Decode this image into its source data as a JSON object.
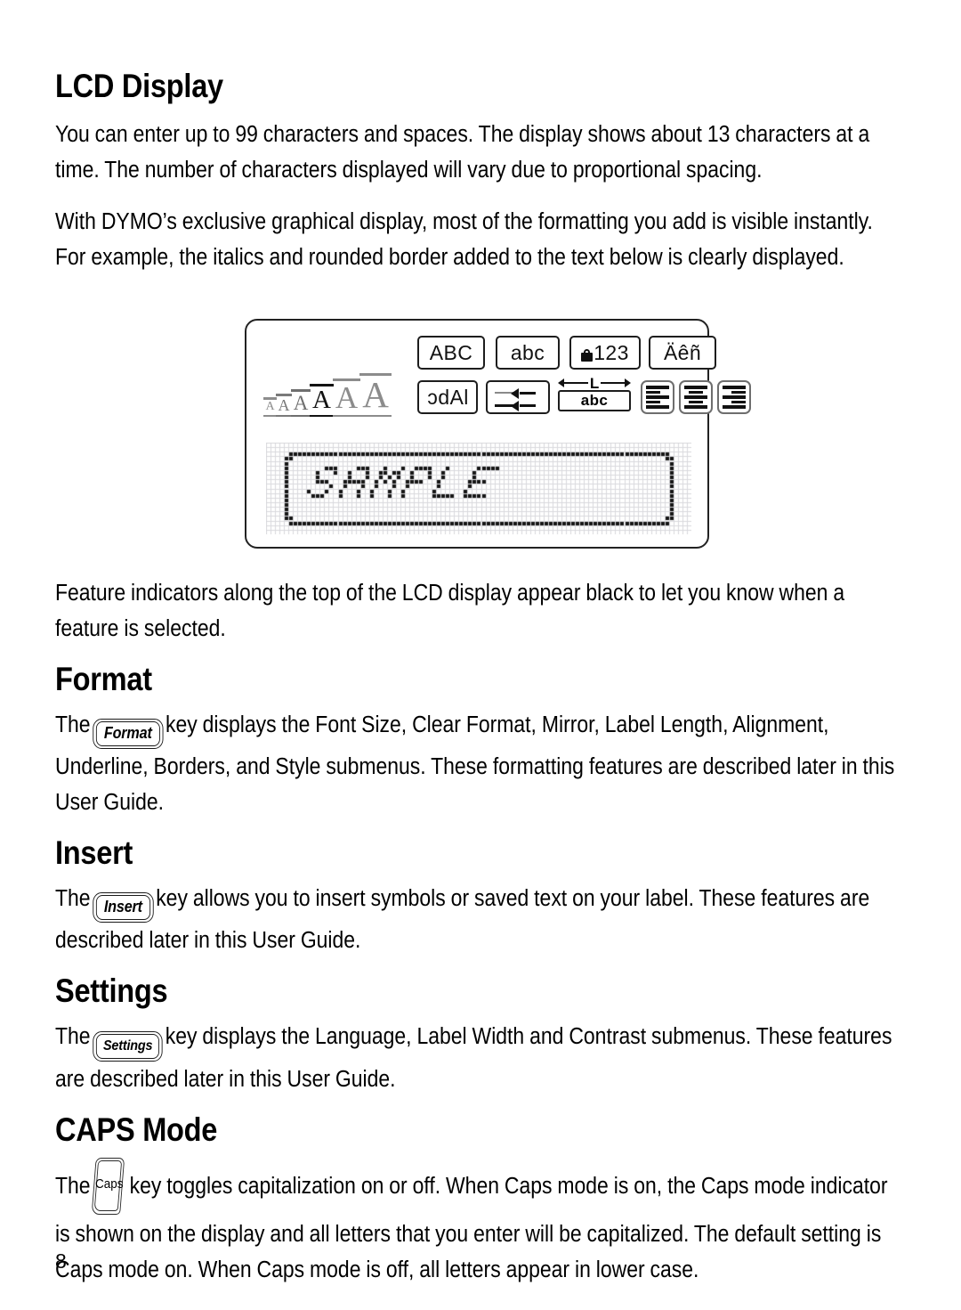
{
  "page": {
    "number": "8"
  },
  "sections": [
    {
      "id": "lcd-display",
      "title": "LCD Display",
      "paragraphs": [
        "You can enter up to 99 characters and spaces. The display shows about 13 characters at a time. The number of characters displayed will vary due to proportional spacing.",
        "With DYMO’s exclusive graphical display, most of the formatting you add is visible instantly. For example, the italics and rounded border added to the text below is clearly displayed."
      ],
      "caption": "Feature indicators along the top of the LCD display appear black to let you know when a feature is selected."
    },
    {
      "id": "format",
      "title": "Format",
      "key_label": "Format",
      "text_before": "The",
      "text_after": "key displays the Font Size, Clear Format, Mirror, Label Length, Alignment, Underline, Borders, and Style submenus. These formatting features are described later in this User Guide."
    },
    {
      "id": "insert",
      "title": "Insert",
      "key_label": "Insert",
      "text_before": "The",
      "text_after": "key allows you to insert symbols or saved text on your label. These features are described later in this User Guide."
    },
    {
      "id": "settings",
      "title": "Settings",
      "key_label": "Settings",
      "text_before": "The",
      "text_after": "key displays the Language, Label Width and Contrast submenus. These features are described later in this User Guide."
    },
    {
      "id": "caps-mode",
      "title": "CAPS Mode",
      "key_label": "Caps",
      "text_before": "The",
      "text_after": "key toggles capitalization on or off. When Caps mode is on, the Caps mode indicator is shown on the display and all letters that you enter will be capitalized. The default setting is Caps mode on. When Caps mode is off, all letters appear in lower case."
    }
  ],
  "lcd": {
    "font_size_indicator": {
      "name": "font-size-steps",
      "glyph": "A",
      "steps": 6,
      "selected_index": 3,
      "sizes": [
        14,
        18,
        23,
        29,
        35,
        41
      ],
      "colors": [
        "#8d8d8d",
        "#7a7a7a",
        "#6f6f6f",
        "#121212",
        "#8c8c8c",
        "#8c8c8c"
      ]
    },
    "indicators_row1": [
      {
        "name": "caps-indicator",
        "text": "ABC"
      },
      {
        "name": "lowercase-indicator",
        "text": "abc"
      },
      {
        "name": "numlock-indicator",
        "text": "123",
        "icon": "lock-icon"
      },
      {
        "name": "accents-indicator",
        "text": "Äêñ"
      }
    ],
    "indicators_row2": [
      {
        "name": "mirror-indicator",
        "text": "lAbc"
      },
      {
        "name": "underline-indicator",
        "icon": "underline-arrows-icon"
      },
      {
        "name": "label-length-indicator",
        "text": "abc",
        "measure": "L"
      },
      {
        "name": "align-left-indicator",
        "icon": "align-left-icon"
      },
      {
        "name": "align-center-indicator",
        "icon": "align-center-icon"
      },
      {
        "name": "align-right-indicator",
        "icon": "align-right-icon"
      }
    ],
    "screen": {
      "name": "dot-matrix-screen",
      "text": "SAMPLE",
      "style": "italic",
      "border": "rounded",
      "cols": 95,
      "rows": 20
    }
  }
}
